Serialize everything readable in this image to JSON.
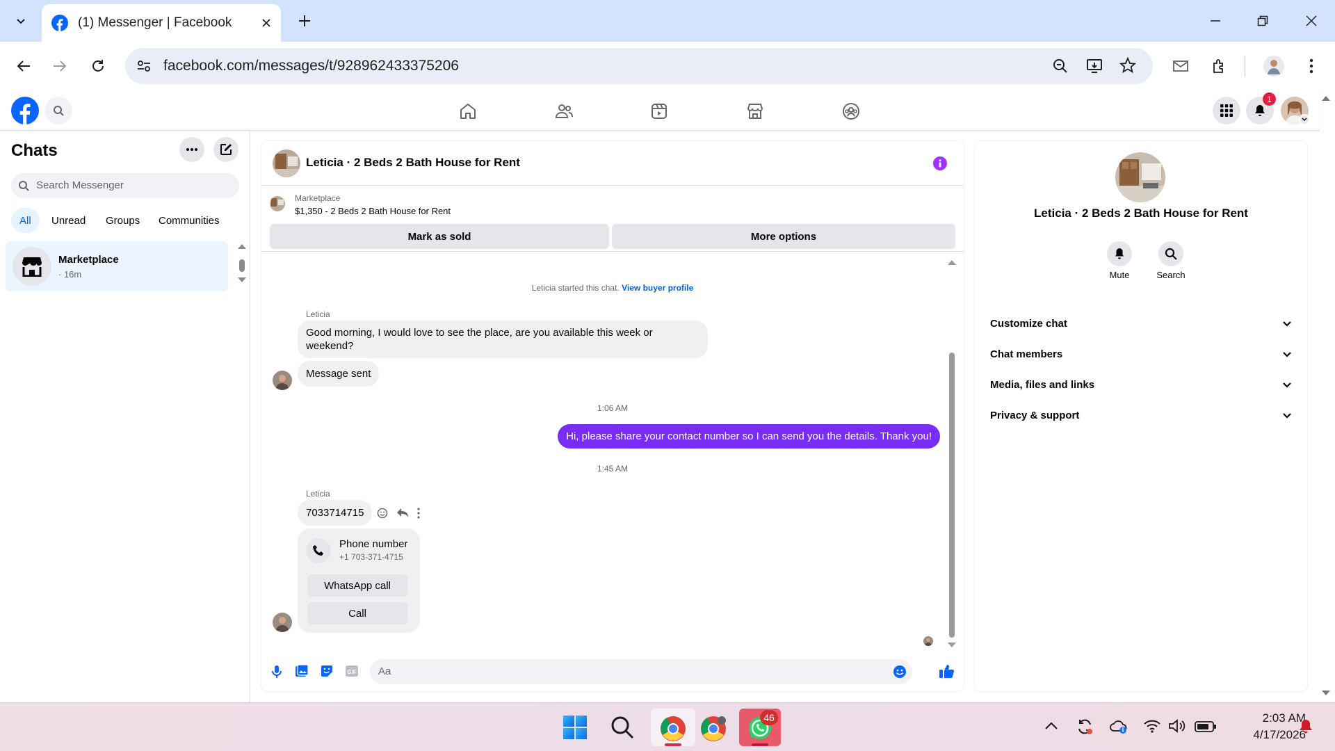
{
  "browser": {
    "tab_title": "(1) Messenger | Facebook",
    "url": "facebook.com/messages/t/928962433375206"
  },
  "fbnav": {
    "notification_count": "1"
  },
  "sidebar": {
    "title": "Chats",
    "search_placeholder": "Search Messenger",
    "filters": [
      "All",
      "Unread",
      "Groups",
      "Communities"
    ],
    "active_filter": "All",
    "chat_items": [
      {
        "name": "Marketplace",
        "time": "· 16m"
      }
    ]
  },
  "chat": {
    "title": "Leticia · 2 Beds 2 Bath House for Rent",
    "listing": {
      "source": "Marketplace",
      "summary": "$1,350 - 2 Beds 2 Bath House for Rent",
      "mark_sold": "Mark as sold",
      "more_options": "More options"
    },
    "system_text": "Leticia started this chat.",
    "system_link": "View buyer profile",
    "messages": [
      {
        "sender": "Leticia",
        "text": "Good morning, I would love to see the place, are you available this week or weekend?"
      },
      {
        "sender": "Leticia",
        "text": "Message sent"
      },
      {
        "timestamp": "1:06 AM"
      },
      {
        "sender": "me",
        "text": "Hi, please share your contact number so I can send you the details. Thank you!"
      },
      {
        "timestamp": "1:45 AM"
      },
      {
        "sender": "Leticia",
        "text": "7033714715"
      }
    ],
    "phone_card": {
      "title": "Phone number",
      "number": "+1 703-371-4715",
      "whatsapp_label": "WhatsApp call",
      "call_label": "Call"
    },
    "composer_placeholder": "Aa",
    "accent_color": "#7a2cf7"
  },
  "info_panel": {
    "title": "Leticia · 2 Beds 2 Bath House for Rent",
    "actions": [
      {
        "label": "Mute",
        "icon": "bell-icon"
      },
      {
        "label": "Search",
        "icon": "search-icon"
      }
    ],
    "sections": [
      "Customize chat",
      "Chat members",
      "Media, files and links",
      "Privacy & support"
    ]
  },
  "taskbar": {
    "whatsapp_badge": "46",
    "time": "2:03 AM",
    "date": "4/17/2026"
  }
}
